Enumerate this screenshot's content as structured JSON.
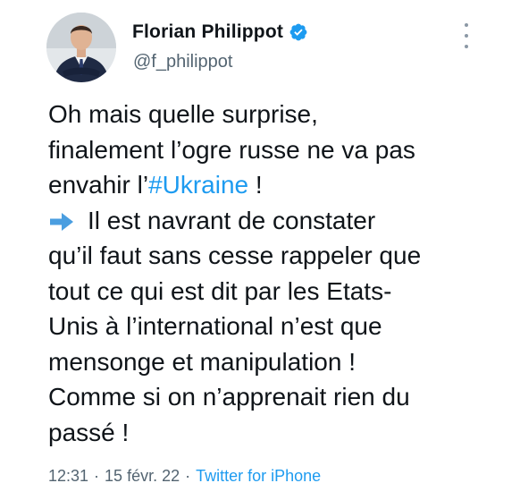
{
  "author": {
    "display_name": "Florian Philippot",
    "handle": "@f_philippot",
    "verified": true
  },
  "tweet": {
    "lines": [
      "Oh mais quelle surprise,",
      "finalement l’ogre russe ne va pas"
    ],
    "line3_prefix": "envahir l’",
    "hashtag": "#Ukraine",
    "line3_suffix": " !",
    "line4": "Il est navrant de constater",
    "more_lines": [
      "qu’il faut sans cesse rappeler que",
      "tout ce qui est dit par les Etats-",
      "Unis à l’international n’est que",
      "mensonge et manipulation !",
      "Comme si on n’apprenait rien du",
      "passé !"
    ]
  },
  "meta": {
    "time": "12:31",
    "separator": "·",
    "date": "15 févr. 22",
    "source": "Twitter for iPhone"
  },
  "icons": {
    "verified": "verified-badge-icon",
    "arrow": "right-arrow-icon",
    "more": "more-options-icon"
  },
  "colors": {
    "link": "#1d9bf0",
    "text": "#0f1419",
    "secondary": "#536471"
  }
}
